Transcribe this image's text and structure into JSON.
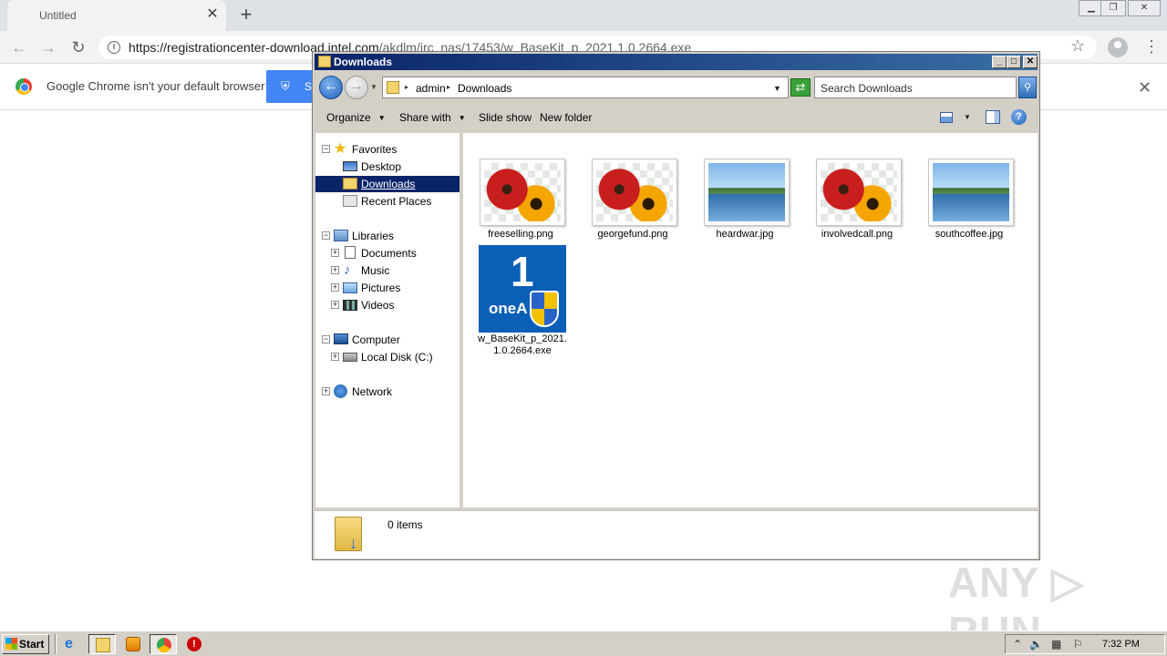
{
  "browser": {
    "tab_title": "Untitled",
    "tab_close": "✕",
    "new_tab": "+",
    "url_host": "https://registrationcenter-download.intel.com",
    "url_path": "/akdlm/irc_nas/17453/w_BaseKit_p_2021.1.0.2664.exe",
    "infobar_text": "Google Chrome isn't your default browser",
    "infobar_button": "S",
    "infobar_close": "✕"
  },
  "explorer": {
    "title": "Downloads",
    "address": {
      "crumbs": [
        "admin",
        "Downloads"
      ]
    },
    "search_placeholder": "Search Downloads",
    "commands": {
      "organize": "Organize",
      "share_with": "Share with",
      "slide_show": "Slide show",
      "new_folder": "New folder"
    },
    "nav": {
      "favorites": "Favorites",
      "desktop": "Desktop",
      "downloads": "Downloads",
      "recent_places": "Recent Places",
      "libraries": "Libraries",
      "documents": "Documents",
      "music": "Music",
      "pictures": "Pictures",
      "videos": "Videos",
      "computer": "Computer",
      "local_disk": "Local Disk (C:)",
      "network": "Network"
    },
    "files": [
      {
        "name": "freeselling.png",
        "icon": "flower-thumbnail"
      },
      {
        "name": "georgefund.png",
        "icon": "flower-thumbnail"
      },
      {
        "name": "heardwar.jpg",
        "icon": "lake-thumbnail"
      },
      {
        "name": "involvedcall.png",
        "icon": "flower-thumbnail"
      },
      {
        "name": "southcoffee.jpg",
        "icon": "lake-thumbnail"
      },
      {
        "name_line1": "w_BaseKit_p_2021.",
        "name_line2": "1.0.2664.exe",
        "icon": "oneapi-installer-icon",
        "icon_text_big": "1",
        "icon_text_word": "oneA"
      }
    ],
    "status_text": "0 items"
  },
  "watermark": "ANY ▷ RUN",
  "taskbar": {
    "start_label": "Start",
    "clock": "7:32 PM",
    "stop_glyph": "!"
  },
  "colors": {
    "titlebar": "#0a246a",
    "selection": "#0a246a",
    "chrome_blue": "#4285f4"
  }
}
